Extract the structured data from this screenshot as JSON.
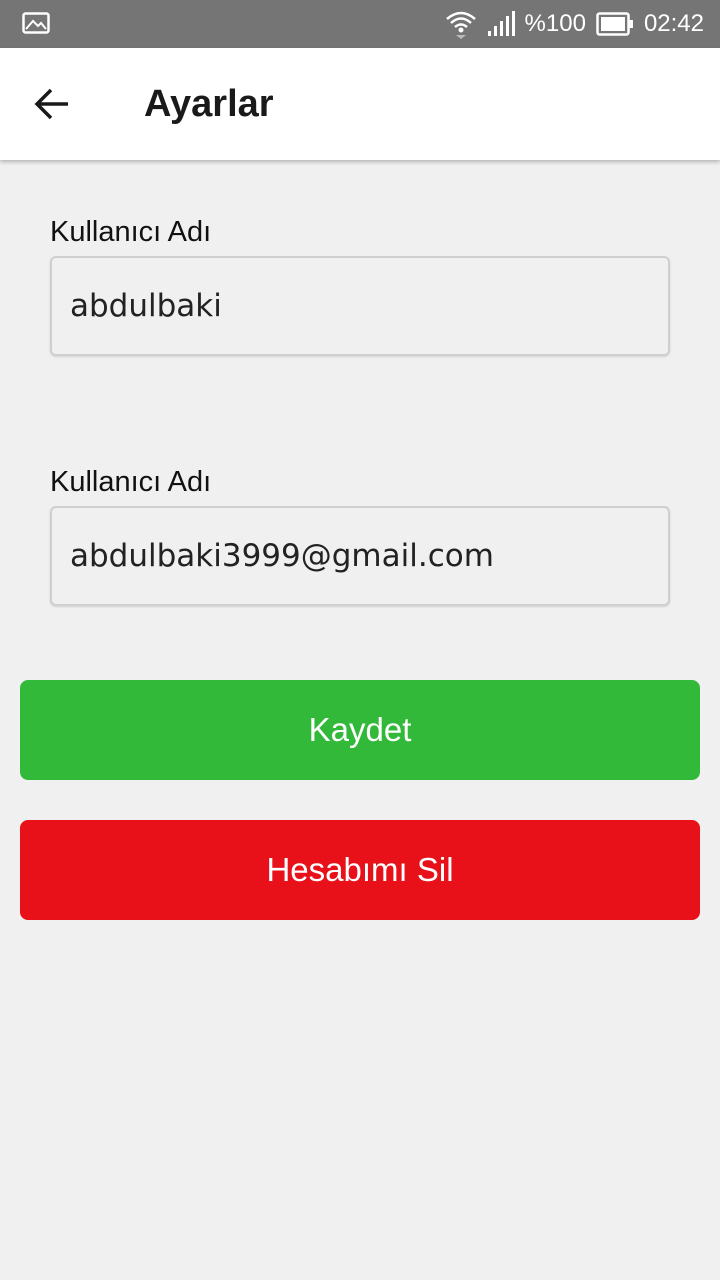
{
  "status_bar": {
    "battery_text": "%100",
    "time": "02:42",
    "left_icon": "image-icon",
    "icons": [
      "wifi-icon",
      "signal-icon",
      "battery-icon"
    ]
  },
  "app_bar": {
    "back_icon": "arrow-left-icon",
    "title": "Ayarlar"
  },
  "form": {
    "username": {
      "label": "Kullanıcı Adı",
      "value": "abdulbaki"
    },
    "email": {
      "label": "Kullanıcı Adı",
      "value": "abdulbaki3999@gmail.com"
    }
  },
  "buttons": {
    "save_label": "Kaydet",
    "delete_label": "Hesabımı Sil"
  },
  "colors": {
    "status_bar": "#757575",
    "background": "#f0f0f0",
    "save_button": "#33b93a",
    "delete_button": "#e81019"
  }
}
